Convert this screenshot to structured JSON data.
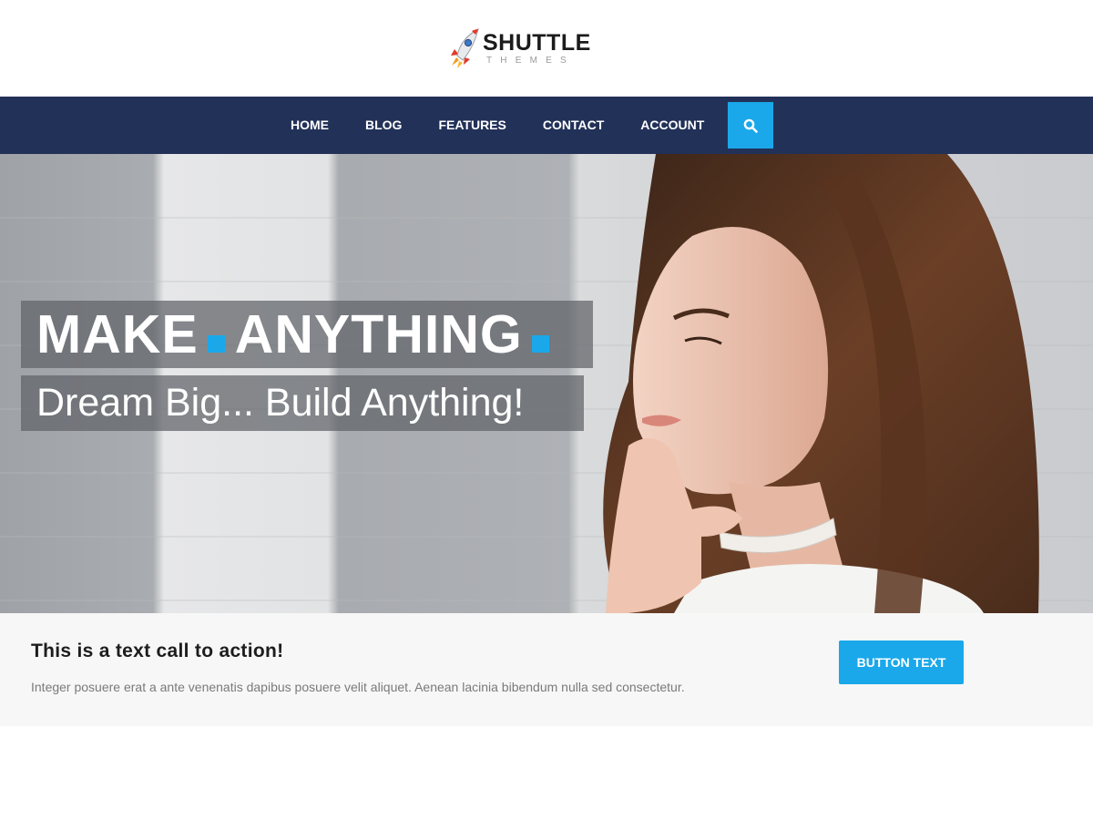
{
  "brand": {
    "name": "SHUTTLE",
    "tagline": "THEMES",
    "logo_icon": "rocket-icon"
  },
  "nav": {
    "items": [
      {
        "label": "HOME"
      },
      {
        "label": "BLOG"
      },
      {
        "label": "FEATURES"
      },
      {
        "label": "CONTACT"
      },
      {
        "label": "ACCOUNT"
      }
    ],
    "search_icon": "search-icon"
  },
  "hero": {
    "title_word_1": "MAKE",
    "title_word_2": "ANYTHING",
    "subtitle": "Dream Big... Build Anything!"
  },
  "cta": {
    "title": "This is a text call to action!",
    "text": "Integer posuere erat a ante venenatis dapibus posuere velit aliquet. Aenean lacinia bibendum nulla sed consectetur.",
    "button_label": "BUTTON TEXT"
  },
  "colors": {
    "nav_bg": "#223158",
    "accent": "#1aa8ea",
    "cta_bg": "#f7f7f7"
  }
}
